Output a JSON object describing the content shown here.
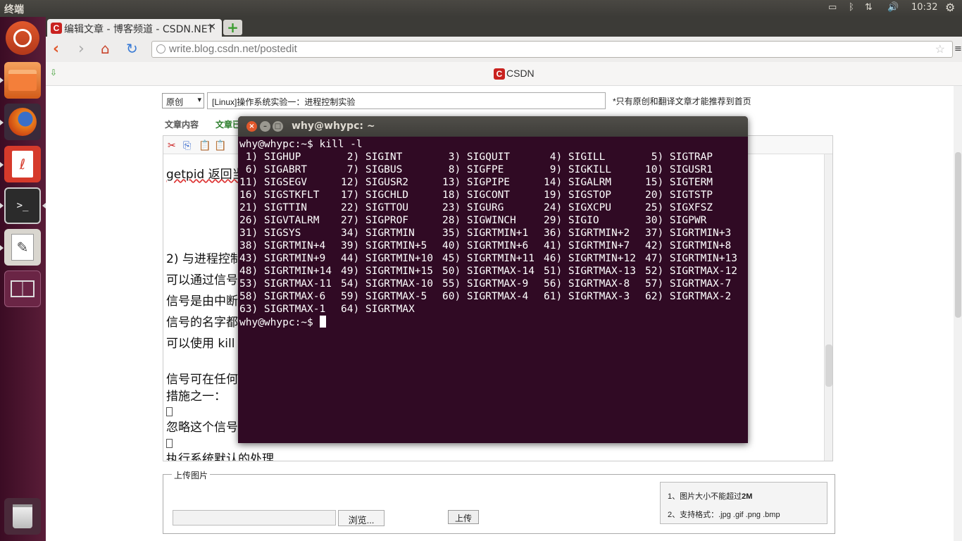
{
  "panel": {
    "title": "终端",
    "clock": "10:32"
  },
  "browser": {
    "tab_title": "编辑文章 - 博客频道 - CSDN.NET",
    "tab_favicon": "C",
    "url": "write.blog.csdn.net/postedit",
    "logo_text": "CSDN",
    "logo_letter": "C"
  },
  "page": {
    "type_value": "原创",
    "title_value": "[Linux]操作系统实验一：进程控制实验",
    "original_note": "*只有原创和翻译文章才能推荐到首页",
    "tab_content": "文章内容",
    "tab_summary": "文章已",
    "editor_lines": [
      "getpid 返回当",
      "2) 与进程控制",
      "可以通过信号",
      "信号是由中断",
      "信号的名字都",
      "可以使用 kill",
      "信号可在任何",
      "措施之一：",
      "忽略这个信号",
      "执行系统默认的处理"
    ],
    "upload_legend": "上传图片",
    "browse_label": "浏览...",
    "upload_label": "上传",
    "upload_rule_1_prefix": "1、图片大小不能超过",
    "upload_rule_1_bold": "2M",
    "upload_rule_2": "2、支持格式：.jpg .gif .png .bmp"
  },
  "terminal": {
    "title": "why@whypc: ~",
    "prompt": "why@whypc:~$",
    "command": "kill -l",
    "signals": [
      "1) SIGHUP",
      "2) SIGINT",
      "3) SIGQUIT",
      "4) SIGILL",
      "5) SIGTRAP",
      "6) SIGABRT",
      "7) SIGBUS",
      "8) SIGFPE",
      "9) SIGKILL",
      "10) SIGUSR1",
      "11) SIGSEGV",
      "12) SIGUSR2",
      "13) SIGPIPE",
      "14) SIGALRM",
      "15) SIGTERM",
      "16) SIGSTKFLT",
      "17) SIGCHLD",
      "18) SIGCONT",
      "19) SIGSTOP",
      "20) SIGTSTP",
      "21) SIGTTIN",
      "22) SIGTTOU",
      "23) SIGURG",
      "24) SIGXCPU",
      "25) SIGXFSZ",
      "26) SIGVTALRM",
      "27) SIGPROF",
      "28) SIGWINCH",
      "29) SIGIO",
      "30) SIGPWR",
      "31) SIGSYS",
      "34) SIGRTMIN",
      "35) SIGRTMIN+1",
      "36) SIGRTMIN+2",
      "37) SIGRTMIN+3",
      "38) SIGRTMIN+4",
      "39) SIGRTMIN+5",
      "40) SIGRTMIN+6",
      "41) SIGRTMIN+7",
      "42) SIGRTMIN+8",
      "43) SIGRTMIN+9",
      "44) SIGRTMIN+10",
      "45) SIGRTMIN+11",
      "46) SIGRTMIN+12",
      "47) SIGRTMIN+13",
      "48) SIGRTMIN+14",
      "49) SIGRTMIN+15",
      "50) SIGRTMAX-14",
      "51) SIGRTMAX-13",
      "52) SIGRTMAX-12",
      "53) SIGRTMAX-11",
      "54) SIGRTMAX-10",
      "55) SIGRTMAX-9",
      "56) SIGRTMAX-8",
      "57) SIGRTMAX-7",
      "58) SIGRTMAX-6",
      "59) SIGRTMAX-5",
      "60) SIGRTMAX-4",
      "61) SIGRTMAX-3",
      "62) SIGRTMAX-2",
      "63) SIGRTMAX-1",
      "64) SIGRTMAX"
    ]
  },
  "launcher_icons": [
    "ubuntu-dash-icon",
    "files-icon",
    "firefox-icon",
    "document-viewer-icon",
    "terminal-icon",
    "text-editor-icon",
    "workspace-switcher-icon",
    "trash-icon"
  ],
  "colors": {
    "terminal_bg": "#300a24",
    "launcher_bg": "#4a1530",
    "csdn_red": "#c9221f",
    "close_orange": "#e0582c"
  }
}
